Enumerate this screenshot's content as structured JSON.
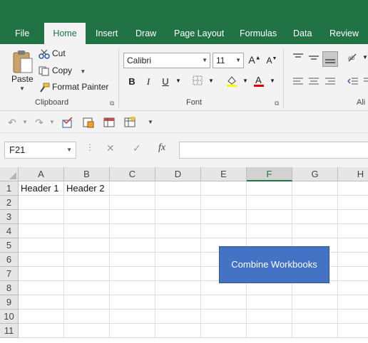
{
  "ribbon_tabs": [
    "File",
    "Home",
    "Insert",
    "Draw",
    "Page Layout",
    "Formulas",
    "Data",
    "Review"
  ],
  "active_tab": "Home",
  "clipboard": {
    "paste_label": "Paste",
    "cut_label": "Cut",
    "copy_label": "Copy",
    "format_painter_label": "Format Painter",
    "group_label": "Clipboard"
  },
  "font": {
    "font_name": "Calibri",
    "font_size": "11",
    "group_label": "Font",
    "bold": "B",
    "italic": "I",
    "underline": "U"
  },
  "alignment": {
    "group_label_partial": "Ali"
  },
  "name_box": {
    "value": "F21"
  },
  "formula_bar": {
    "fx_label": "fx",
    "value": ""
  },
  "grid": {
    "columns": [
      "A",
      "B",
      "C",
      "D",
      "E",
      "F",
      "G",
      "H"
    ],
    "selected_column": "F",
    "rows": [
      "1",
      "2",
      "3",
      "4",
      "5",
      "6",
      "7",
      "8",
      "9",
      "10",
      "11"
    ],
    "cells": {
      "A1": "Header 1",
      "B1": "Header 2"
    }
  },
  "combine_button": {
    "label": "Combine Workbooks"
  },
  "colors": {
    "excel_green": "#217346",
    "button_blue": "#4472c4",
    "font_color_red": "#e00000",
    "highlight_yellow": "#ffff00"
  }
}
